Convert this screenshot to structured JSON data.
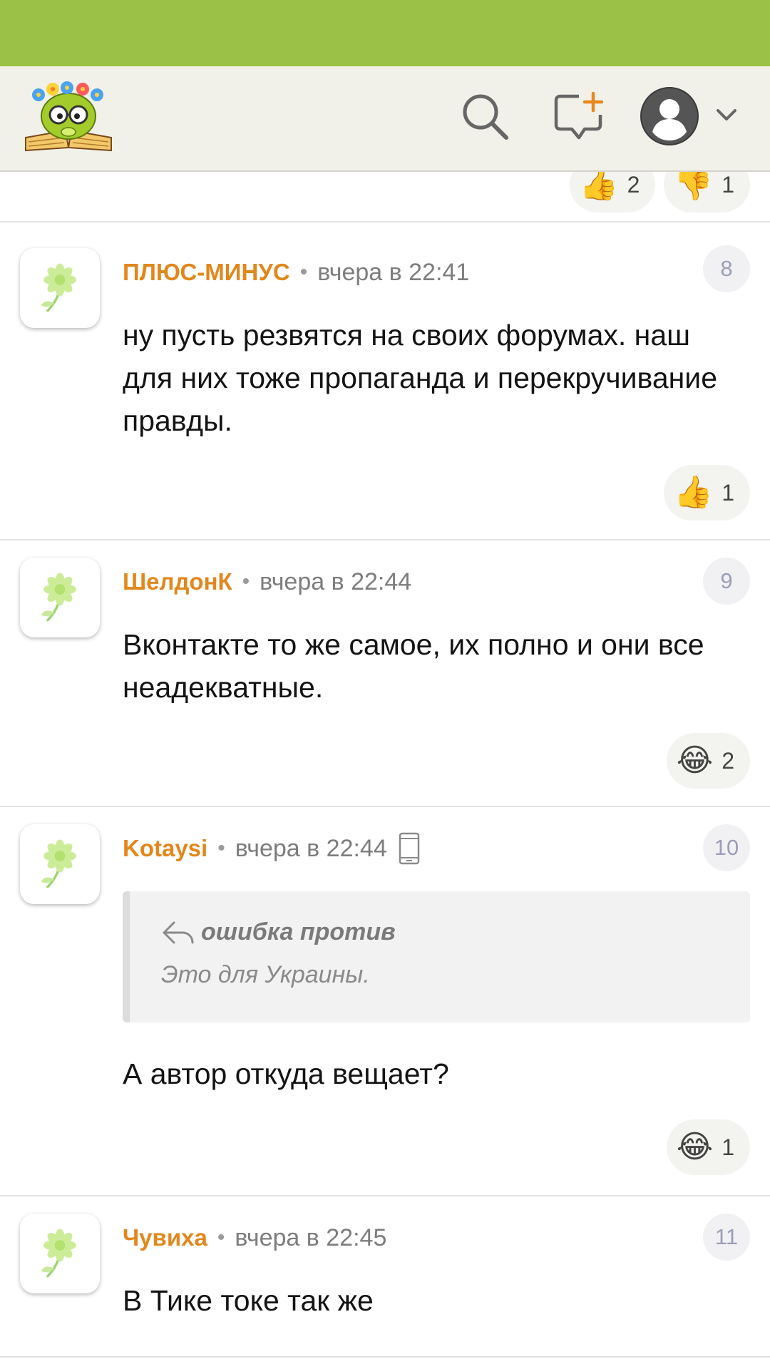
{
  "header": {
    "search_icon": "search-icon",
    "new_post_icon": "new-post-icon",
    "profile_icon": "profile-icon",
    "dropdown_icon": "chevron-down-icon"
  },
  "previous_comment": {
    "reactions": [
      {
        "emoji": "👍",
        "count": "2"
      },
      {
        "emoji": "👎",
        "count": "1"
      }
    ]
  },
  "comments": [
    {
      "author": "ПЛЮС-МИНУС",
      "time": "вчера в 22:41",
      "number": "8",
      "text": "ну пусть резвятся на своих форумах. наш для них тоже пропаганда и перекручивание правды.",
      "reaction": {
        "emoji": "👍",
        "count": "1"
      }
    },
    {
      "author": "ШелдонК",
      "time": "вчера в 22:44",
      "number": "9",
      "text": "Вконтакте то же самое, их полно и они все неадекватные.",
      "reaction": {
        "emoji": "😂",
        "count": "2"
      }
    },
    {
      "author": "Kotaysi",
      "time": "вчера в 22:44",
      "number": "10",
      "mobile": true,
      "quote": {
        "author": "ошибка против",
        "text": "Это для Украины."
      },
      "text": "А автор откуда вещает?",
      "reaction": {
        "emoji": "😂",
        "count": "1"
      }
    },
    {
      "author": "Чувиха",
      "time": "вчера в 22:45",
      "number": "11",
      "text": "В Тике токе так же"
    }
  ],
  "colors": {
    "status_bar": "#9bc146",
    "header_bg": "#f1f1ea",
    "author": "#e2871c",
    "badge_text": "#9a9eb5"
  }
}
